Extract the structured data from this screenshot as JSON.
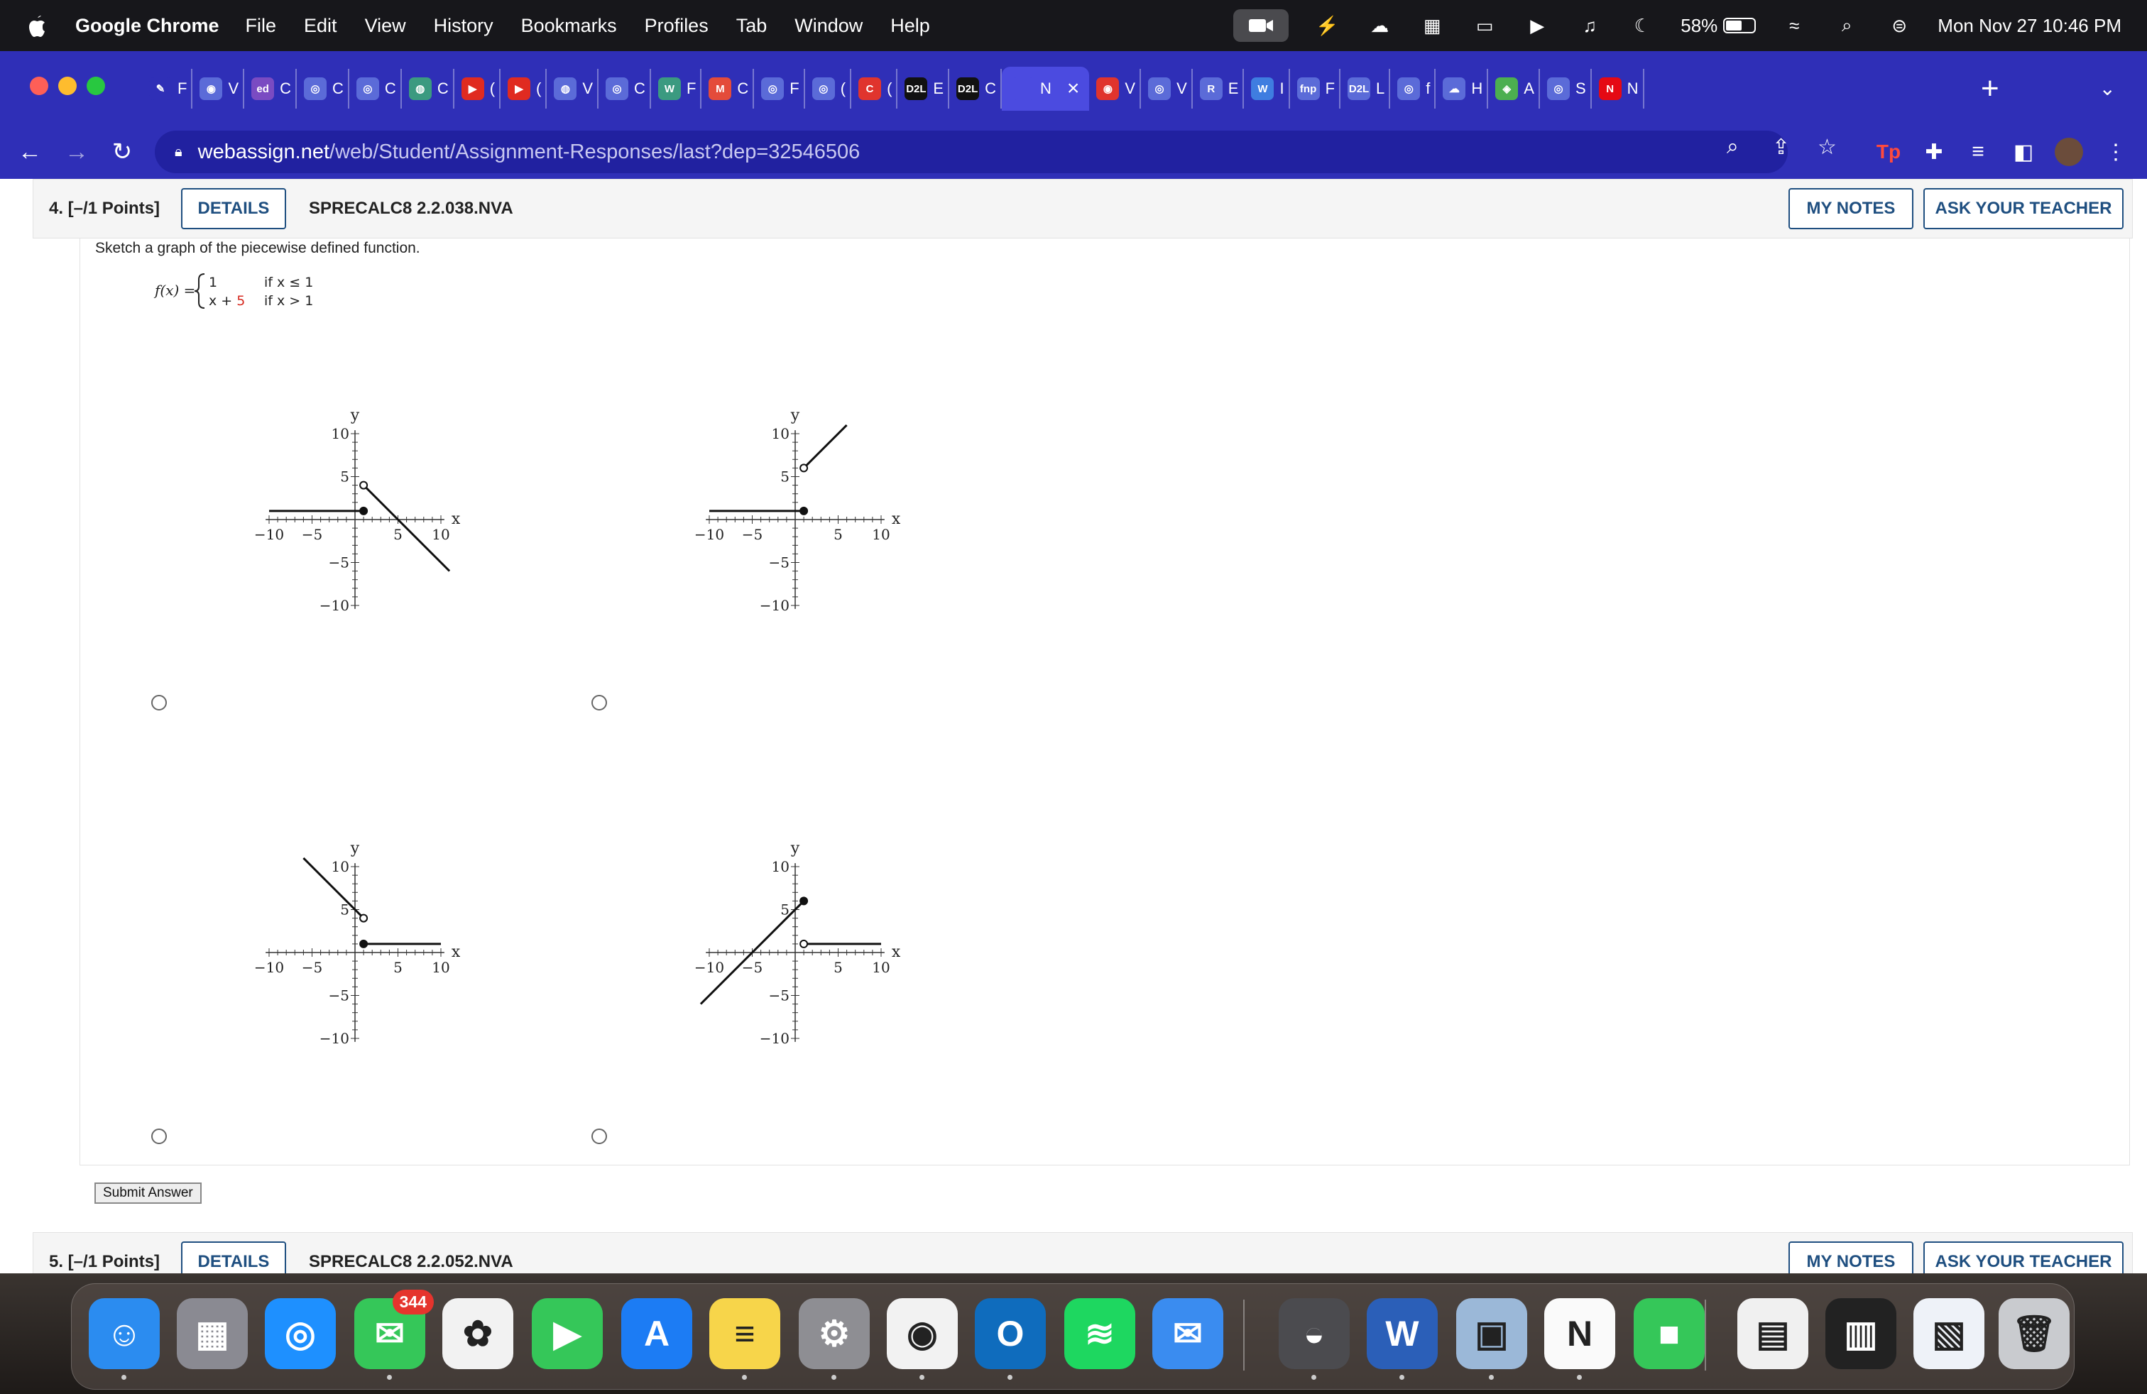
{
  "menubar": {
    "app_name": "Google Chrome",
    "items": [
      "File",
      "Edit",
      "View",
      "History",
      "Bookmarks",
      "Profiles",
      "Tab",
      "Window",
      "Help"
    ],
    "battery": "58%",
    "battery_level": 0.58,
    "clock": "Mon Nov 27  10:46 PM"
  },
  "tabs": [
    {
      "fav": "✎",
      "label": "F",
      "color": "#2f2fb7"
    },
    {
      "fav": "◉",
      "label": "V",
      "color": "#5b6bd8"
    },
    {
      "fav": "ed",
      "label": "C",
      "color": "#7a4bc2"
    },
    {
      "fav": "◎",
      "label": "C",
      "color": "#5b6bd8"
    },
    {
      "fav": "◎",
      "label": "C",
      "color": "#5b6bd8"
    },
    {
      "fav": "◍",
      "label": "C",
      "color": "#3b9a80"
    },
    {
      "fav": "▶",
      "label": "(",
      "color": "#e02b20"
    },
    {
      "fav": "▶",
      "label": "(",
      "color": "#e02b20"
    },
    {
      "fav": "◍",
      "label": "V",
      "color": "#5b6bd8"
    },
    {
      "fav": "◎",
      "label": "C",
      "color": "#5b6bd8"
    },
    {
      "fav": "W",
      "label": "F",
      "color": "#3b9a80"
    },
    {
      "fav": "M",
      "label": "C",
      "color": "#e44b3a"
    },
    {
      "fav": "◎",
      "label": "F",
      "color": "#5b6bd8"
    },
    {
      "fav": "◎",
      "label": "(",
      "color": "#5b6bd8"
    },
    {
      "fav": "C",
      "label": "(",
      "color": "#e0342d"
    },
    {
      "fav": "D2L",
      "label": "E",
      "color": "#111"
    },
    {
      "fav": "D2L",
      "label": "C",
      "color": "#111"
    },
    {
      "fav": "",
      "label": "N",
      "color": "#4b4be0",
      "active": true
    },
    {
      "fav": "◉",
      "label": "V",
      "color": "#e0342d"
    },
    {
      "fav": "◎",
      "label": "V",
      "color": "#5b6bd8"
    },
    {
      "fav": "R",
      "label": "E",
      "color": "#5b6bd8"
    },
    {
      "fav": "W",
      "label": "I",
      "color": "#3f7de0"
    },
    {
      "fav": "fnp",
      "label": "F",
      "color": "#5b6bd8"
    },
    {
      "fav": "D2L",
      "label": "L",
      "color": "#5b6bd8"
    },
    {
      "fav": "◎",
      "label": "f",
      "color": "#5b6bd8"
    },
    {
      "fav": "☁",
      "label": "H",
      "color": "#5b6bd8"
    },
    {
      "fav": "◈",
      "label": "A",
      "color": "#4caf50"
    },
    {
      "fav": "◎",
      "label": "S",
      "color": "#5b6bd8"
    },
    {
      "fav": "N",
      "label": "N",
      "color": "#e50914"
    }
  ],
  "url": {
    "host": "webassign.net",
    "path": "/web/Student/Assignment-Responses/last?dep=32546506"
  },
  "question4": {
    "number": "4.  [–/1 Points]",
    "details": "DETAILS",
    "code": "SPRECALC8 2.2.038.NVA",
    "my_notes": "MY NOTES",
    "ask_teacher": "ASK YOUR TEACHER",
    "prompt": "Sketch a graph of the piecewise defined function.",
    "func_name": "f(x) =",
    "case1_expr": "1",
    "case1_cond": "if x ≤ 1",
    "case2_expr_a": "x + ",
    "case2_expr_b": "5",
    "case2_cond": "if x > 1",
    "submit": "Submit Answer"
  },
  "question5": {
    "number": "5.  [–/1 Points]",
    "details": "DETAILS",
    "code": "SPRECALC8 2.2.052.NVA",
    "my_notes": "MY NOTES",
    "ask_teacher": "ASK YOUR TEACHER"
  },
  "axes": {
    "xlabel": "x",
    "ylabel": "y",
    "ticks": [
      "−10",
      "−5",
      "5",
      "10"
    ]
  },
  "chart_data": [
    {
      "type": "line",
      "option": "A",
      "xlim": [
        -10,
        10
      ],
      "ylim": [
        -10,
        10
      ],
      "segments": [
        {
          "points": [
            [
              -10,
              1
            ],
            [
              1,
              1
            ]
          ],
          "end": "closed"
        },
        {
          "points": [
            [
              1,
              4
            ],
            [
              11,
              -6
            ]
          ],
          "start": "open"
        }
      ]
    },
    {
      "type": "line",
      "option": "B",
      "xlim": [
        -10,
        10
      ],
      "ylim": [
        -10,
        10
      ],
      "segments": [
        {
          "points": [
            [
              -10,
              1
            ],
            [
              1,
              1
            ]
          ],
          "end": "closed"
        },
        {
          "points": [
            [
              1,
              6
            ],
            [
              6,
              11
            ]
          ],
          "start": "open"
        }
      ]
    },
    {
      "type": "line",
      "option": "C",
      "xlim": [
        -10,
        10
      ],
      "ylim": [
        -10,
        10
      ],
      "segments": [
        {
          "points": [
            [
              -6,
              11
            ],
            [
              1,
              4
            ]
          ],
          "end": "open"
        },
        {
          "points": [
            [
              1,
              1
            ],
            [
              10,
              1
            ]
          ],
          "start": "closed"
        }
      ]
    },
    {
      "type": "line",
      "option": "D",
      "xlim": [
        -10,
        10
      ],
      "ylim": [
        -10,
        10
      ],
      "segments": [
        {
          "points": [
            [
              -11,
              -6
            ],
            [
              1,
              6
            ]
          ],
          "end": "closed"
        },
        {
          "points": [
            [
              1,
              1
            ],
            [
              10,
              1
            ]
          ],
          "start": "open"
        }
      ]
    }
  ],
  "dock": [
    {
      "name": "finder",
      "glyph": "☺",
      "bg": "#2b8cf0",
      "dot": true
    },
    {
      "name": "launchpad",
      "glyph": "▦",
      "bg": "#8a8a92",
      "dot": false
    },
    {
      "name": "safari",
      "glyph": "◎",
      "bg": "#1e90ff",
      "dot": false
    },
    {
      "name": "messages",
      "glyph": "✉",
      "bg": "#35c759",
      "dot": true,
      "badge": "344"
    },
    {
      "name": "photos",
      "glyph": "✿",
      "bg": "#f2f2f2",
      "dot": false
    },
    {
      "name": "facetime",
      "glyph": "▶",
      "bg": "#35c759",
      "dot": false
    },
    {
      "name": "app-store",
      "glyph": "A",
      "bg": "#1c7cf4",
      "dot": false
    },
    {
      "name": "notes",
      "glyph": "≡",
      "bg": "#f7d54a",
      "dot": true
    },
    {
      "name": "system-settings",
      "glyph": "⚙",
      "bg": "#8e8e93",
      "dot": true
    },
    {
      "name": "chrome",
      "glyph": "◉",
      "bg": "#f2f2f2",
      "dot": true
    },
    {
      "name": "outlook",
      "glyph": "O",
      "bg": "#0f6cbd",
      "dot": true
    },
    {
      "name": "spotify",
      "glyph": "≋",
      "bg": "#1ed760",
      "dot": false
    },
    {
      "name": "mail",
      "glyph": "✉",
      "bg": "#3a8cf0",
      "dot": false
    },
    {
      "name": "app-1",
      "glyph": "◒",
      "bg": "#4b4b4f",
      "dot": true
    },
    {
      "name": "word",
      "glyph": "W",
      "bg": "#2b5fb8",
      "dot": true
    },
    {
      "name": "preview",
      "glyph": "▣",
      "bg": "#9bb8d8",
      "dot": true
    },
    {
      "name": "notion",
      "glyph": "N",
      "bg": "#fafafa",
      "dot": true
    },
    {
      "name": "zoom",
      "glyph": "■",
      "bg": "#35c759",
      "dot": false
    },
    {
      "name": "doc-pdf",
      "glyph": "▤",
      "bg": "#f0f0f0",
      "dot": false
    },
    {
      "name": "doc-screen",
      "glyph": "▥",
      "bg": "#222",
      "dot": false
    },
    {
      "name": "doc-browser",
      "glyph": "▧",
      "bg": "#eef2f8",
      "dot": false
    },
    {
      "name": "trash",
      "glyph": "🗑",
      "bg": "#c9cbcf",
      "dot": false
    }
  ]
}
